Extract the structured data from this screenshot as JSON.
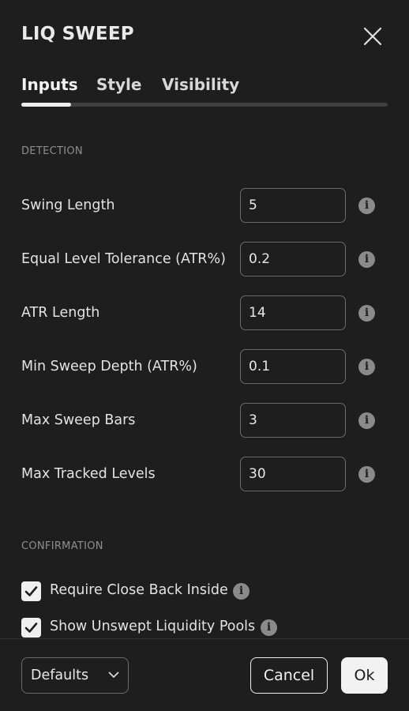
{
  "dialog": {
    "title": "LIQ SWEEP",
    "close_icon": "close-icon"
  },
  "tabs": [
    {
      "label": "Inputs",
      "active": true
    },
    {
      "label": "Style",
      "active": false
    },
    {
      "label": "Visibility",
      "active": false
    }
  ],
  "sections": {
    "detection": "DETECTION",
    "confirmation": "CONFIRMATION"
  },
  "inputs": [
    {
      "label": "Swing Length",
      "value": "5"
    },
    {
      "label": "Equal Level Tolerance (ATR%)",
      "value": "0.2"
    },
    {
      "label": "ATR Length",
      "value": "14"
    },
    {
      "label": "Min Sweep Depth (ATR%)",
      "value": "0.1"
    },
    {
      "label": "Max Sweep Bars",
      "value": "3"
    },
    {
      "label": "Max Tracked Levels",
      "value": "30"
    }
  ],
  "checkboxes": [
    {
      "label": "Require Close Back Inside",
      "checked": true
    },
    {
      "label": "Show Unswept Liquidity Pools",
      "checked": true
    }
  ],
  "info_glyph": "i",
  "footer": {
    "defaults_label": "Defaults",
    "cancel_label": "Cancel",
    "ok_label": "Ok"
  },
  "colors": {
    "background": "#1e1e1e",
    "text": "#e8e8e8",
    "muted": "#8e8e8e",
    "border": "#6a6a6a"
  }
}
